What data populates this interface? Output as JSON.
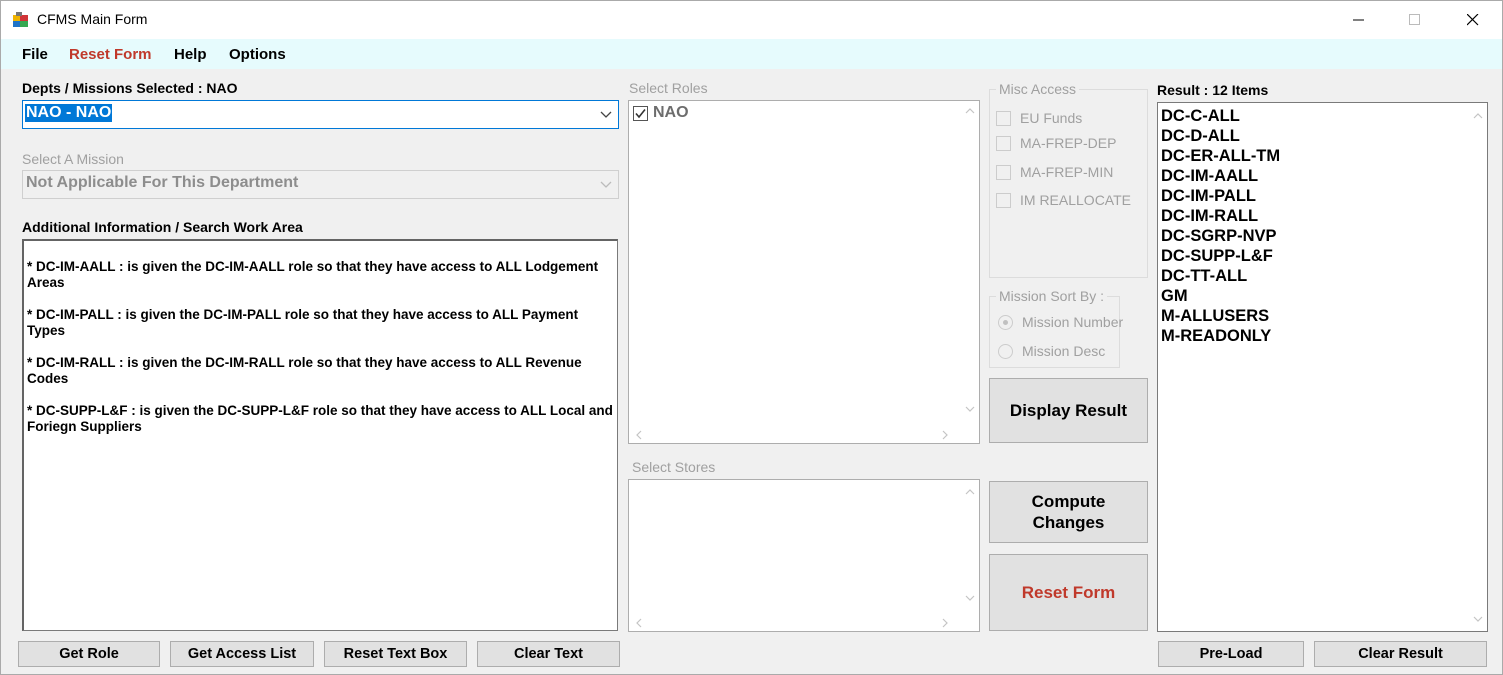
{
  "window": {
    "title": "CFMS Main Form"
  },
  "menu": {
    "file": "File",
    "reset_form": "Reset Form",
    "help": "Help",
    "options": "Options"
  },
  "depts": {
    "label": "Depts / Missions Selected : NAO",
    "selected": "NAO - NAO"
  },
  "mission": {
    "label": "Select A Mission",
    "selected": "Not Applicable For This Department"
  },
  "info": {
    "label": "Additional Information / Search Work Area",
    "paragraphs": [
      "* DC-IM-AALL : is given the DC-IM-AALL role so that they have access to ALL Lodgement Areas",
      "* DC-IM-PALL : is given the DC-IM-PALL role so that they have access to ALL Payment Types",
      "* DC-IM-RALL : is given the DC-IM-RALL role so that they have access to ALL Revenue Codes",
      "* DC-SUPP-L&F : is given the DC-SUPP-L&F role so that they have access to ALL Local and Foriegn Suppliers"
    ]
  },
  "roles": {
    "label": "Select Roles",
    "items": [
      "NAO"
    ]
  },
  "stores": {
    "label": "Select Stores"
  },
  "misc_access": {
    "title": "Misc Access",
    "items": [
      "EU Funds",
      "MA-FREP-DEP",
      "MA-FREP-MIN",
      "IM REALLOCATE"
    ]
  },
  "sort": {
    "title": "Mission Sort By :",
    "options": [
      "Mission Number",
      "Mission Desc"
    ],
    "selected": "Mission Number"
  },
  "buttons": {
    "display_result": "Display Result",
    "compute_changes": "Compute Changes",
    "reset_form": "Reset Form",
    "get_role": "Get Role",
    "get_access_list": "Get Access List",
    "reset_text_box": "Reset Text Box",
    "clear_text": "Clear Text",
    "pre_load": "Pre-Load",
    "clear_result": "Clear Result"
  },
  "result": {
    "label": "Result : 12 Items",
    "items": [
      "DC-C-ALL",
      "DC-D-ALL",
      "DC-ER-ALL-TM",
      "DC-IM-AALL",
      "DC-IM-PALL",
      "DC-IM-RALL",
      "DC-SGRP-NVP",
      "DC-SUPP-L&F",
      "DC-TT-ALL",
      "GM",
      "M-ALLUSERS",
      "M-READONLY"
    ]
  },
  "colors": {
    "menubar": "#e6fbfd",
    "selection": "#0078d7",
    "danger": "#c0392b"
  },
  "icons": [
    "app-icon",
    "minimize-icon",
    "maximize-icon",
    "close-icon",
    "chevron-down-icon",
    "scroll-arrow-icon",
    "checkbox-checked-icon"
  ]
}
